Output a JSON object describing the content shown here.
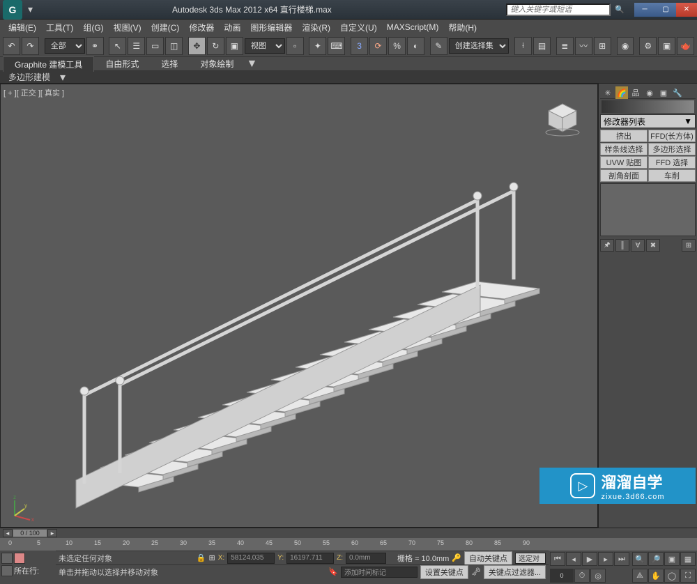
{
  "title": "Autodesk 3ds Max  2012 x64     直行楼梯.max",
  "search_placeholder": "键入关键字或短语",
  "menu": [
    "编辑(E)",
    "工具(T)",
    "组(G)",
    "视图(V)",
    "创建(C)",
    "修改器",
    "动画",
    "图形编辑器",
    "渲染(R)",
    "自定义(U)",
    "MAXScript(M)",
    "帮助(H)"
  ],
  "toolbar": {
    "scope_dropdown": "全部",
    "view_dropdown": "视图",
    "selection_set": "创建选择集"
  },
  "ribbon": {
    "tabs": [
      "Graphite 建模工具",
      "自由形式",
      "选择",
      "对象绘制"
    ],
    "sub_label": "多边形建模"
  },
  "viewport": {
    "label": "[ + ][ 正交 ][ 真实 ]"
  },
  "right_panel": {
    "modifier_list": "修改器列表",
    "buttons": [
      "挤出",
      "FFD(长方体)",
      "样条线选择",
      "多边形选择",
      "UVW 贴图",
      "FFD 选择",
      "剖角剖面",
      "车削"
    ]
  },
  "timeline": {
    "frame": "0 / 100",
    "ticks": [
      "0",
      "5",
      "10",
      "15",
      "20",
      "25",
      "30",
      "35",
      "40",
      "45",
      "50",
      "55",
      "60",
      "65",
      "70",
      "75",
      "80",
      "85",
      "90"
    ]
  },
  "status": {
    "now_label": "所在行:",
    "msg1": "未选定任何对象",
    "msg2": "单击并拖动以选择并移动对象",
    "x": "58124.035",
    "y": "16197.711",
    "z": "0.0mm",
    "grid": "栅格 = 10.0mm",
    "auto_key": "自动关键点",
    "selected": "选定对",
    "set_key": "设置关键点",
    "key_filter": "关键点过滤器...",
    "add_marker": "添加时间标记"
  },
  "watermark": {
    "text": "溜溜自学",
    "url": "zixue.3d66.com"
  }
}
